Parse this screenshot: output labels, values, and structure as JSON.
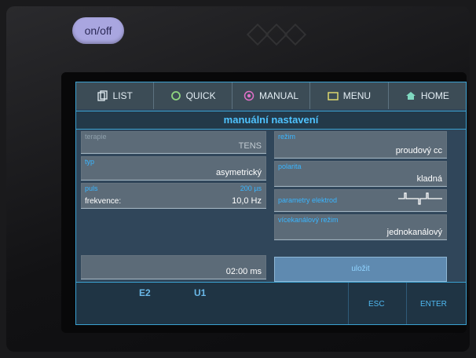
{
  "device": {
    "onoff_label": "on/off"
  },
  "topbar": {
    "tabs": [
      {
        "label": "LIST",
        "icon": "list-icon"
      },
      {
        "label": "QUICK",
        "icon": "circle-icon"
      },
      {
        "label": "MANUAL",
        "icon": "target-icon"
      },
      {
        "label": "MENU",
        "icon": "folder-icon"
      },
      {
        "label": "HOME",
        "icon": "home-icon"
      }
    ]
  },
  "screen_title": "manuální nastavení",
  "fields": {
    "therapy": {
      "label": "terapie",
      "value": "TENS"
    },
    "type": {
      "label": "typ",
      "value": "asymetrický"
    },
    "frequency": {
      "label": "puls",
      "value_top": "200 µs",
      "sub_label": "frekvence:",
      "value": "10,0 Hz"
    },
    "timer": {
      "value": "02:00 ms"
    },
    "mode": {
      "label": "režim",
      "value": "proudový cc"
    },
    "polarity": {
      "label": "polarita",
      "value": "kladná"
    },
    "electrode_params": {
      "label": "parametry elektrod"
    },
    "multichannel": {
      "label": "vícekanálový režim",
      "value": "jednokanálový"
    }
  },
  "save_label": "uložit",
  "bottombar": {
    "e_label": "E2",
    "u_label": "U1",
    "esc_label": "ESC",
    "enter_label": "ENTER"
  },
  "colors": {
    "accent": "#39b5ff",
    "onoff_button": "#a9a6e0",
    "screen_bg": "#30465a"
  }
}
